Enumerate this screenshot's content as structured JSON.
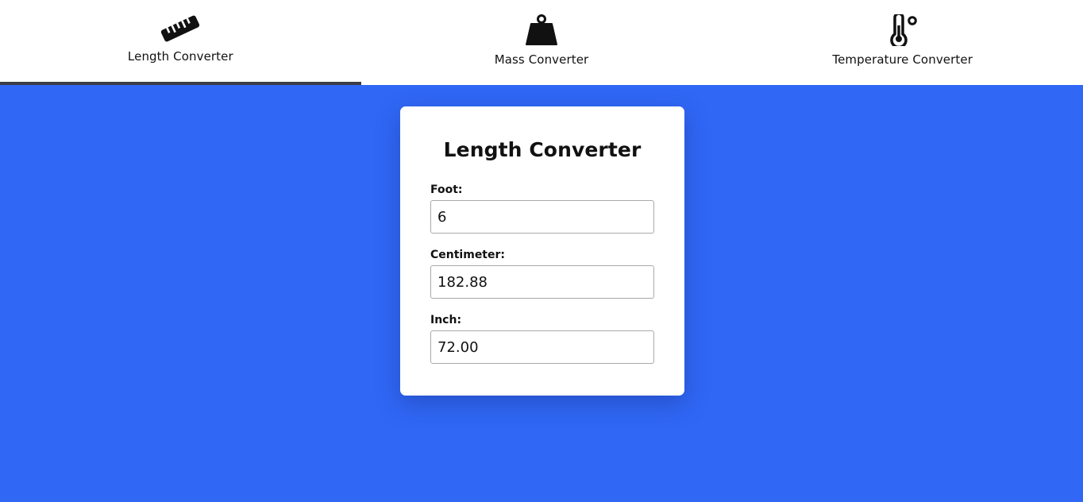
{
  "tabs": [
    {
      "label": "Length Converter",
      "icon": "ruler-icon",
      "active": true
    },
    {
      "label": "Mass Converter",
      "icon": "weight-icon",
      "active": false
    },
    {
      "label": "Temperature Converter",
      "icon": "thermometer-icon",
      "active": false
    }
  ],
  "converter": {
    "title": "Length Converter",
    "fields": [
      {
        "label": "Foot:",
        "value": "6"
      },
      {
        "label": "Centimeter:",
        "value": "182.88"
      },
      {
        "label": "Inch:",
        "value": "72.00"
      }
    ]
  },
  "colors": {
    "background": "#3067f5",
    "tabbar": "#ffffff",
    "active_indicator": "#3a3d44"
  }
}
